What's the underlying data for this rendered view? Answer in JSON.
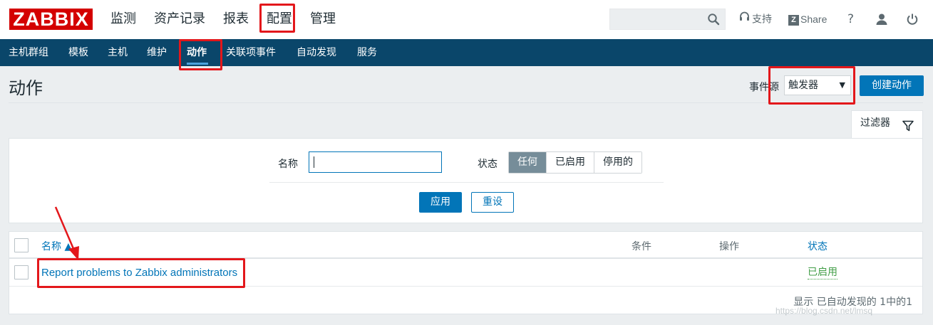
{
  "header": {
    "logo": "ZABBIX",
    "menu": [
      "监测",
      "资产记录",
      "报表",
      "配置",
      "管理"
    ],
    "search": {
      "value": "",
      "placeholder": ""
    },
    "support_label": "支持",
    "share_label": "Share",
    "help_label": "?"
  },
  "subnav": {
    "items": [
      "主机群组",
      "模板",
      "主机",
      "维护",
      "动作",
      "关联项事件",
      "自动发现",
      "服务"
    ],
    "active": "动作"
  },
  "page": {
    "title": "动作",
    "event_source_label": "事件源",
    "event_source_value": "触发器",
    "create_button": "创建动作"
  },
  "filter": {
    "tab_label": "过滤器",
    "name_label": "名称",
    "name_value": "",
    "status_label": "状态",
    "status_options": [
      "任何",
      "已启用",
      "停用的"
    ],
    "status_selected": "任何",
    "apply_label": "应用",
    "reset_label": "重设"
  },
  "table": {
    "columns": {
      "name": "名称 ▲",
      "conditions": "条件",
      "operations": "操作",
      "status": "状态"
    },
    "rows": [
      {
        "name": "Report problems to Zabbix administrators",
        "conditions": "",
        "operations": "",
        "status": "已启用"
      }
    ],
    "footer": "显示 已自动发现的 1中的1"
  },
  "watermark": "https://blog.csdn.net/lmsq",
  "colors": {
    "brand": "#d40000",
    "nav": "#0a466a",
    "accent": "#0275b8",
    "enabled": "#429e47",
    "annotation": "#e3171b"
  }
}
